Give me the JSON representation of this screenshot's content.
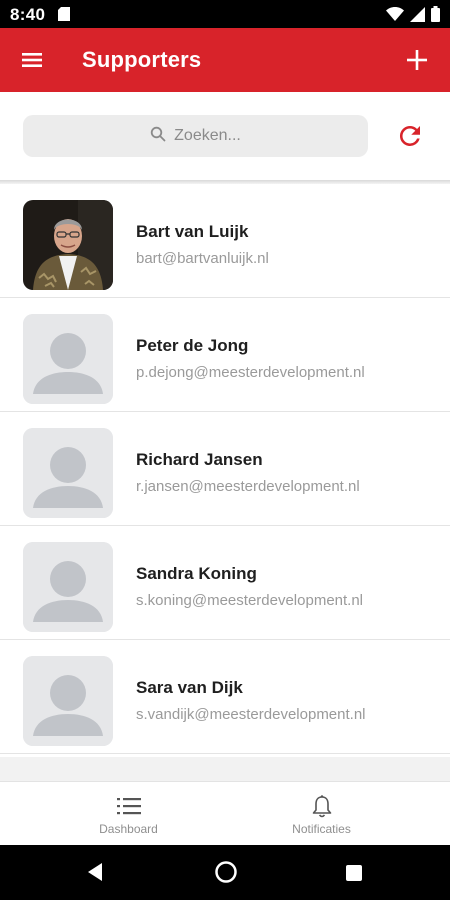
{
  "status_bar": {
    "time": "8:40"
  },
  "app_bar": {
    "title": "Supporters",
    "menu_icon": "menu-icon",
    "add_icon": "plus-icon",
    "color": "#d8232a"
  },
  "search": {
    "placeholder": "Zoeken...",
    "value": ""
  },
  "supporters": [
    {
      "name": "Bart van Luijk",
      "email": "bart@bartvanluijk.nl",
      "has_photo": true
    },
    {
      "name": "Peter de Jong",
      "email": "p.dejong@meesterdevelopment.nl",
      "has_photo": false
    },
    {
      "name": "Richard Jansen",
      "email": "r.jansen@meesterdevelopment.nl",
      "has_photo": false
    },
    {
      "name": "Sandra Koning",
      "email": "s.koning@meesterdevelopment.nl",
      "has_photo": false
    },
    {
      "name": "Sara van Dijk",
      "email": "s.vandijk@meesterdevelopment.nl",
      "has_photo": false
    }
  ],
  "bottom_nav": {
    "items": [
      {
        "label": "Dashboard",
        "icon": "list-icon"
      },
      {
        "label": "Notificaties",
        "icon": "bell-icon"
      }
    ]
  }
}
